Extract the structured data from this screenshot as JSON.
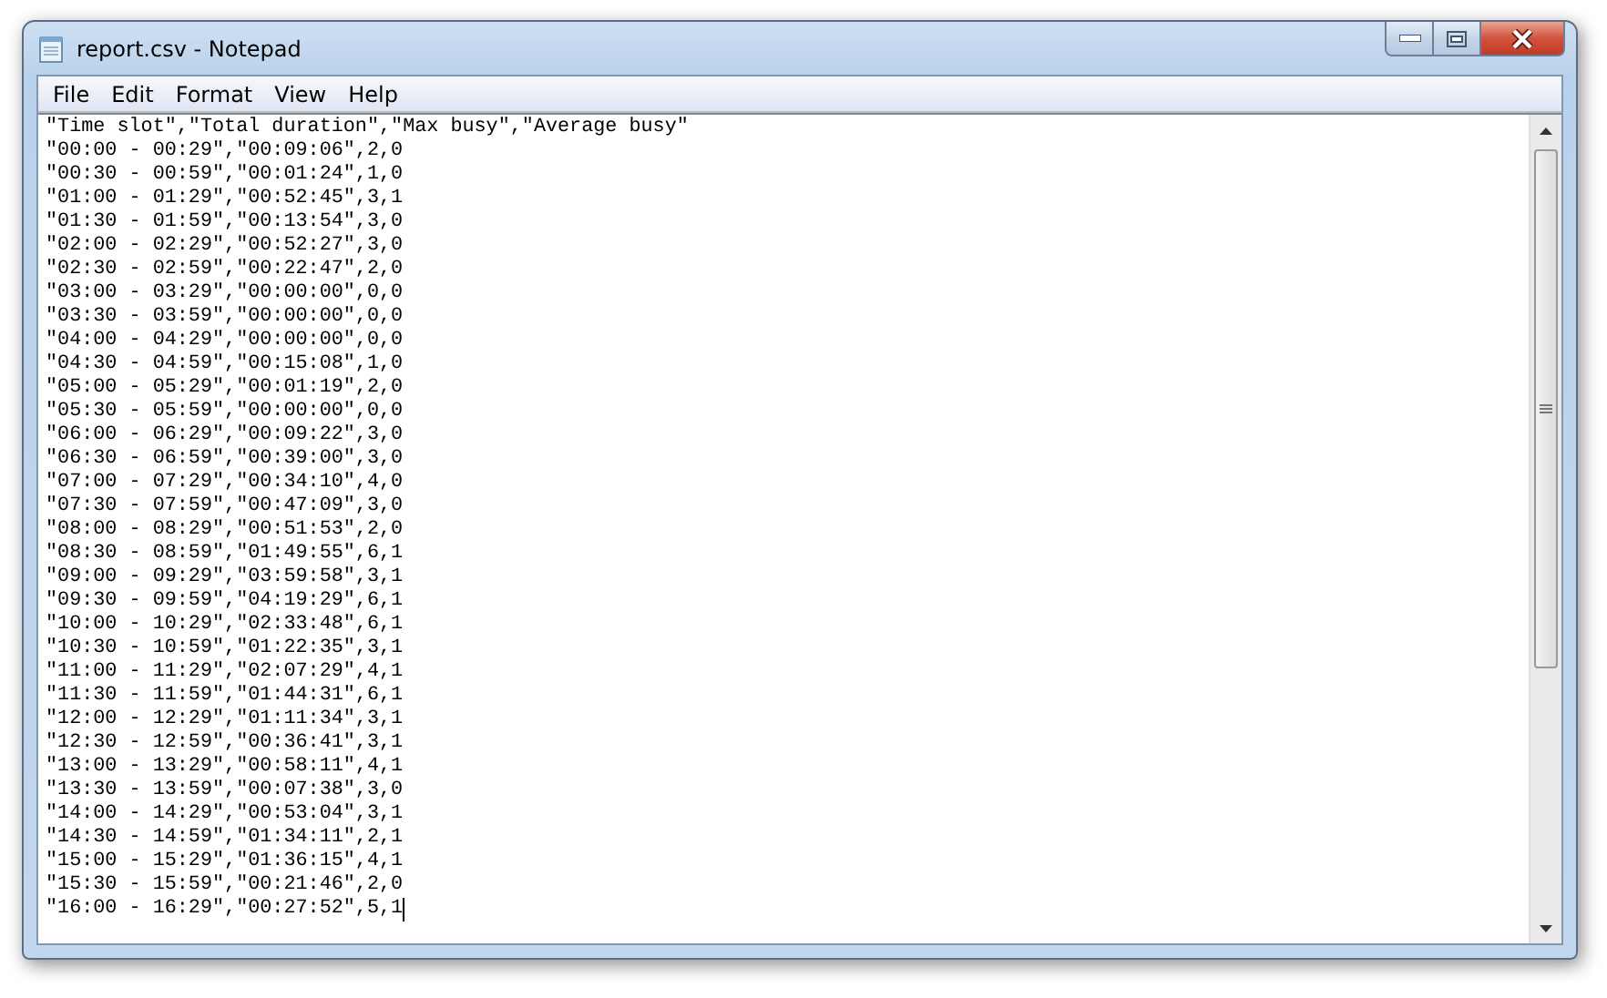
{
  "window": {
    "title": "report.csv - Notepad"
  },
  "menu": [
    "File",
    "Edit",
    "Format",
    "View",
    "Help"
  ],
  "editor": {
    "lines": [
      "\"Time slot\",\"Total duration\",\"Max busy\",\"Average busy\"",
      "\"00:00 - 00:29\",\"00:09:06\",2,0",
      "\"00:30 - 00:59\",\"00:01:24\",1,0",
      "\"01:00 - 01:29\",\"00:52:45\",3,1",
      "\"01:30 - 01:59\",\"00:13:54\",3,0",
      "\"02:00 - 02:29\",\"00:52:27\",3,0",
      "\"02:30 - 02:59\",\"00:22:47\",2,0",
      "\"03:00 - 03:29\",\"00:00:00\",0,0",
      "\"03:30 - 03:59\",\"00:00:00\",0,0",
      "\"04:00 - 04:29\",\"00:00:00\",0,0",
      "\"04:30 - 04:59\",\"00:15:08\",1,0",
      "\"05:00 - 05:29\",\"00:01:19\",2,0",
      "\"05:30 - 05:59\",\"00:00:00\",0,0",
      "\"06:00 - 06:29\",\"00:09:22\",3,0",
      "\"06:30 - 06:59\",\"00:39:00\",3,0",
      "\"07:00 - 07:29\",\"00:34:10\",4,0",
      "\"07:30 - 07:59\",\"00:47:09\",3,0",
      "\"08:00 - 08:29\",\"00:51:53\",2,0",
      "\"08:30 - 08:59\",\"01:49:55\",6,1",
      "\"09:00 - 09:29\",\"03:59:58\",3,1",
      "\"09:30 - 09:59\",\"04:19:29\",6,1",
      "\"10:00 - 10:29\",\"02:33:48\",6,1",
      "\"10:30 - 10:59\",\"01:22:35\",3,1",
      "\"11:00 - 11:29\",\"02:07:29\",4,1",
      "\"11:30 - 11:59\",\"01:44:31\",6,1",
      "\"12:00 - 12:29\",\"01:11:34\",3,1",
      "\"12:30 - 12:59\",\"00:36:41\",3,1",
      "\"13:00 - 13:29\",\"00:58:11\",4,1",
      "\"13:30 - 13:59\",\"00:07:38\",3,0",
      "\"14:00 - 14:29\",\"00:53:04\",3,1",
      "\"14:30 - 14:59\",\"01:34:11\",2,1",
      "\"15:00 - 15:29\",\"01:36:15\",4,1",
      "\"15:30 - 15:59\",\"00:21:46\",2,0",
      "\"16:00 - 16:29\",\"00:27:52\",5,1"
    ]
  }
}
